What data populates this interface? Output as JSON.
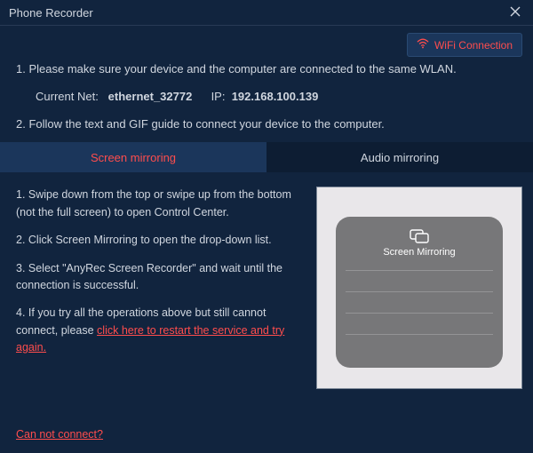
{
  "window": {
    "title": "Phone Recorder"
  },
  "topbar": {
    "wifi_label": "WiFi Connection"
  },
  "intro": {
    "line1": "1. Please make sure your device and the computer are connected to the same WLAN.",
    "net_label": "Current Net:",
    "net_value": "ethernet_32772",
    "ip_label": "IP:",
    "ip_value": "192.168.100.139",
    "line2": "2. Follow the text and GIF guide to connect your device to the computer."
  },
  "tabs": {
    "screen": "Screen mirroring",
    "audio": "Audio mirroring"
  },
  "steps": {
    "s1": "1. Swipe down from the top or swipe up from the bottom (not the full screen) to open Control Center.",
    "s2": "2. Click Screen Mirroring to open the drop-down list.",
    "s3": "3. Select \"AnyRec Screen Recorder\" and wait until the connection is successful.",
    "s4_a": "4. If you try all the operations above but still cannot connect, please ",
    "s4_link": "click here to restart the service and try again."
  },
  "gif": {
    "panel_label": "Screen Mirroring"
  },
  "footer": {
    "cant_connect": "Can not connect?"
  }
}
